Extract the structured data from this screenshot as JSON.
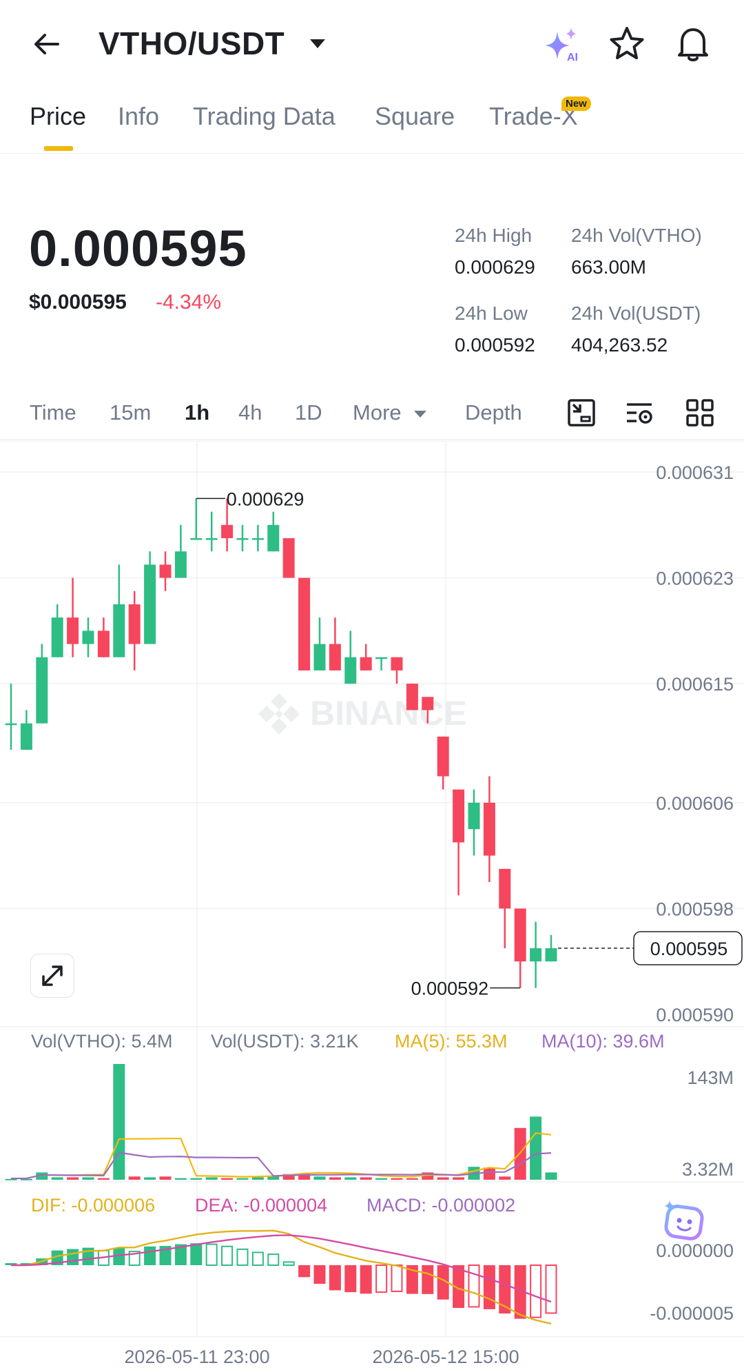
{
  "header": {
    "pair": "VTHO/USDT"
  },
  "tabs": [
    {
      "label": "Price"
    },
    {
      "label": "Info"
    },
    {
      "label": "Trading Data"
    },
    {
      "label": "Square"
    },
    {
      "label": "Trade-X",
      "badge": "New"
    }
  ],
  "ticker": {
    "last_price": "0.000595",
    "usd_price": "$0.000595",
    "change_pct": "-4.34%",
    "high_label": "24h High",
    "high_value": "0.000629",
    "low_label": "24h Low",
    "low_value": "0.000592",
    "vol_base_label": "24h Vol(VTHO)",
    "vol_base_value": "663.00M",
    "vol_quote_label": "24h Vol(USDT)",
    "vol_quote_value": "404,263.52"
  },
  "intervals": {
    "items": [
      "Time",
      "15m",
      "1h",
      "4h",
      "1D"
    ],
    "active": "1h",
    "more": "More",
    "depth": "Depth"
  },
  "chart": {
    "price_ticks": [
      "0.000631",
      "0.000623",
      "0.000615",
      "0.000606",
      "0.000598",
      "0.000590"
    ],
    "current_price_tag": "0.000595",
    "high_marker": "0.000629",
    "low_marker": "0.000592",
    "watermark": "BINANCE",
    "volume_legend": {
      "vol_base": "Vol(VTHO): 5.4M",
      "vol_quote": "Vol(USDT): 3.21K",
      "ma5": "MA(5): 55.3M",
      "ma10": "MA(10): 39.6M"
    },
    "volume_ticks": [
      "143M",
      "3.32M"
    ],
    "macd_legend": {
      "dif": "DIF: -0.000006",
      "dea": "DEA: -0.000004",
      "macd": "MACD: -0.000002"
    },
    "macd_ticks": [
      "0.000000",
      "-0.000005"
    ],
    "time_labels": [
      "2026-05-11 23:00",
      "2026-05-12 15:00"
    ],
    "colors": {
      "up": "#2ebd85",
      "down": "#f6465d",
      "ma5": "#f0b90b",
      "ma10": "#9c6bc3",
      "dif": "#e3b21c",
      "dea": "#d44ba6"
    }
  },
  "chart_data": {
    "type": "candlestick",
    "candles": [
      {
        "o": 0.000612,
        "h": 0.000615,
        "l": 0.00061,
        "c": 0.000612
      },
      {
        "o": 0.00061,
        "h": 0.000613,
        "l": 0.00061,
        "c": 0.000612
      },
      {
        "o": 0.000612,
        "h": 0.000618,
        "l": 0.000612,
        "c": 0.000617
      },
      {
        "o": 0.000617,
        "h": 0.000621,
        "l": 0.000617,
        "c": 0.00062
      },
      {
        "o": 0.00062,
        "h": 0.000623,
        "l": 0.000617,
        "c": 0.000618
      },
      {
        "o": 0.000618,
        "h": 0.00062,
        "l": 0.000617,
        "c": 0.000619
      },
      {
        "o": 0.000619,
        "h": 0.00062,
        "l": 0.000617,
        "c": 0.000617
      },
      {
        "o": 0.000617,
        "h": 0.000624,
        "l": 0.000617,
        "c": 0.000621
      },
      {
        "o": 0.000621,
        "h": 0.000622,
        "l": 0.000616,
        "c": 0.000618
      },
      {
        "o": 0.000618,
        "h": 0.000625,
        "l": 0.000618,
        "c": 0.000624
      },
      {
        "o": 0.000624,
        "h": 0.000625,
        "l": 0.000622,
        "c": 0.000623
      },
      {
        "o": 0.000623,
        "h": 0.000627,
        "l": 0.000623,
        "c": 0.000625
      },
      {
        "o": 0.000626,
        "h": 0.000629,
        "l": 0.000626,
        "c": 0.000626
      },
      {
        "o": 0.000626,
        "h": 0.000628,
        "l": 0.000625,
        "c": 0.000626
      },
      {
        "o": 0.000627,
        "h": 0.000629,
        "l": 0.000625,
        "c": 0.000626
      },
      {
        "o": 0.000626,
        "h": 0.000627,
        "l": 0.000625,
        "c": 0.000626
      },
      {
        "o": 0.000626,
        "h": 0.000627,
        "l": 0.000625,
        "c": 0.000626
      },
      {
        "o": 0.000625,
        "h": 0.000628,
        "l": 0.000625,
        "c": 0.000627
      },
      {
        "o": 0.000626,
        "h": 0.000626,
        "l": 0.000623,
        "c": 0.000623
      },
      {
        "o": 0.000623,
        "h": 0.000623,
        "l": 0.000616,
        "c": 0.000616
      },
      {
        "o": 0.000616,
        "h": 0.00062,
        "l": 0.000616,
        "c": 0.000618
      },
      {
        "o": 0.000618,
        "h": 0.00062,
        "l": 0.000616,
        "c": 0.000616
      },
      {
        "o": 0.000615,
        "h": 0.000619,
        "l": 0.000615,
        "c": 0.000617
      },
      {
        "o": 0.000617,
        "h": 0.000618,
        "l": 0.000616,
        "c": 0.000616
      },
      {
        "o": 0.000617,
        "h": 0.000617,
        "l": 0.000616,
        "c": 0.000617
      },
      {
        "o": 0.000617,
        "h": 0.000617,
        "l": 0.000615,
        "c": 0.000616
      },
      {
        "o": 0.000615,
        "h": 0.000615,
        "l": 0.000613,
        "c": 0.000613
      },
      {
        "o": 0.000614,
        "h": 0.000614,
        "l": 0.000612,
        "c": 0.000613
      },
      {
        "o": 0.000611,
        "h": 0.000611,
        "l": 0.000607,
        "c": 0.000608
      },
      {
        "o": 0.000607,
        "h": 0.000607,
        "l": 0.000599,
        "c": 0.000603
      },
      {
        "o": 0.000604,
        "h": 0.000607,
        "l": 0.000602,
        "c": 0.000606
      },
      {
        "o": 0.000606,
        "h": 0.000608,
        "l": 0.0006,
        "c": 0.000602
      },
      {
        "o": 0.000601,
        "h": 0.000601,
        "l": 0.000595,
        "c": 0.000598
      },
      {
        "o": 0.000598,
        "h": 0.000598,
        "l": 0.000592,
        "c": 0.000594
      },
      {
        "o": 0.000594,
        "h": 0.000597,
        "l": 0.000592,
        "c": 0.000595
      },
      {
        "o": 0.000594,
        "h": 0.000596,
        "l": 0.000594,
        "c": 0.000595
      }
    ],
    "volumes_m": [
      1,
      1,
      9,
      3,
      3,
      3,
      2,
      143,
      4,
      3,
      4,
      2,
      2,
      3,
      2,
      2,
      3,
      4,
      7,
      8,
      4,
      3,
      3,
      3,
      2,
      2,
      2,
      9,
      3,
      3,
      16,
      15,
      4,
      64,
      78,
      9
    ],
    "y_range": [
      0.00059,
      0.000631
    ]
  }
}
